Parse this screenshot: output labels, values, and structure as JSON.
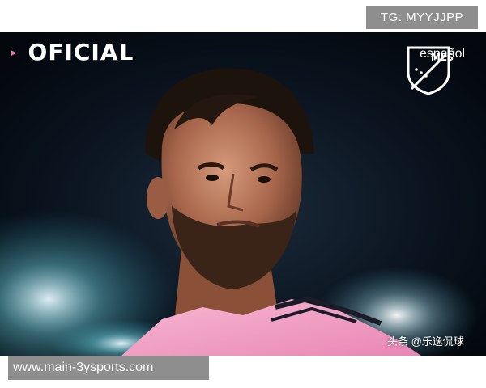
{
  "badges": {
    "telegram": "TG: MYYJJPP",
    "url": "www.main-3ysports.com"
  },
  "photo": {
    "headline": "OFICIAL",
    "headline_marker": "▸",
    "logo": {
      "name": "mls-shield-icon",
      "shield_text": "MLS",
      "subtitle": "español"
    },
    "watermark": "头条 @乐逸侃球"
  },
  "colors": {
    "background": "#060a12",
    "jersey_pink": "#f2a0c4",
    "accent_pink": "#f06fae",
    "badge_gray": "#8e8e8e"
  }
}
